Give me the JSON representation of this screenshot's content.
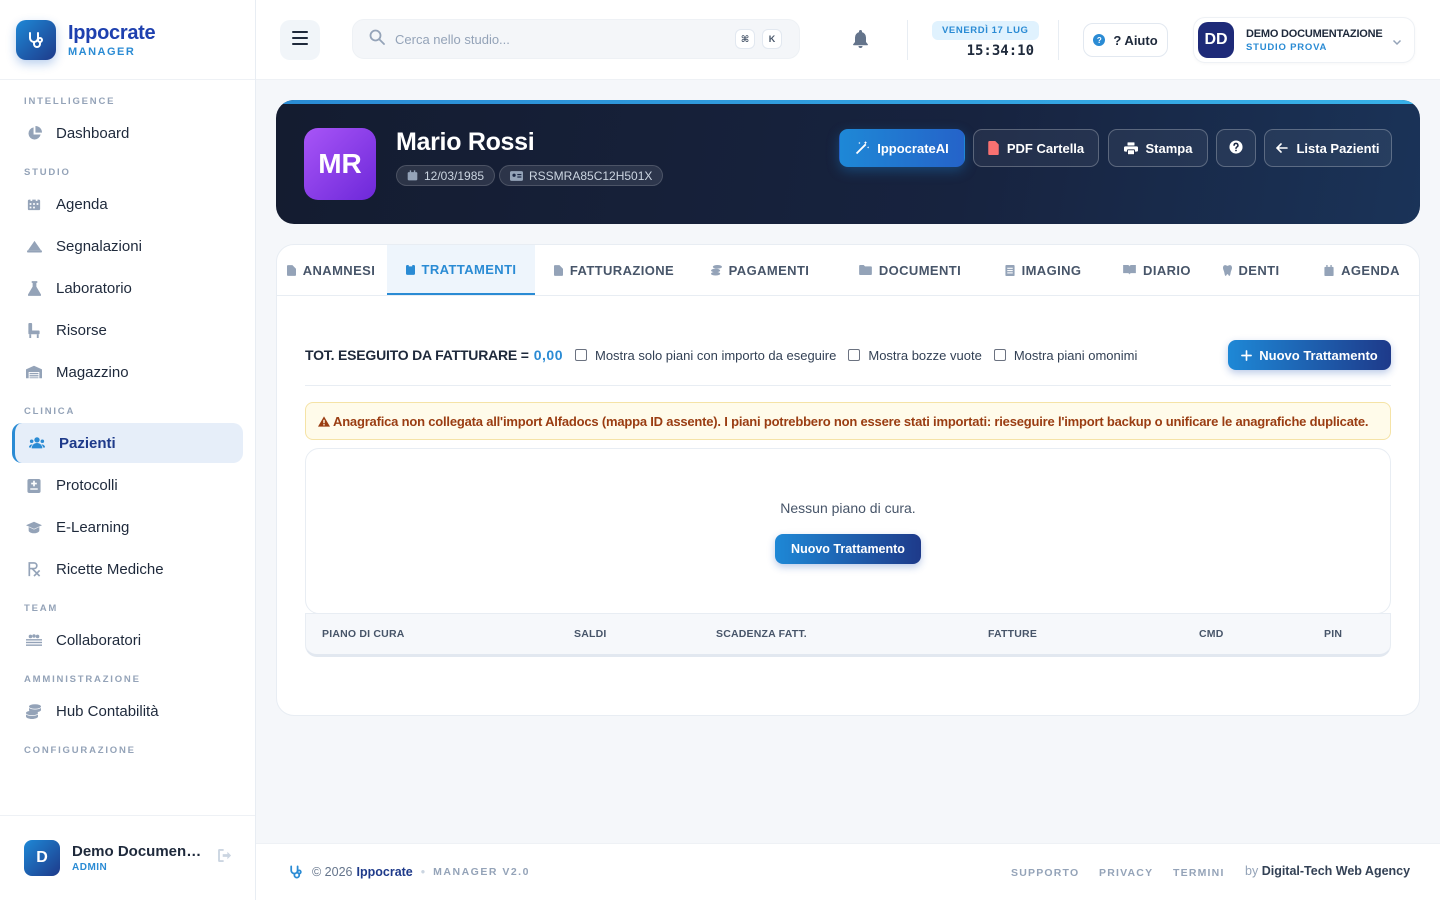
{
  "brand": {
    "name": "Ippocrate",
    "sub": "MANAGER"
  },
  "sidebar": {
    "sections": [
      {
        "title": "INTELLIGENCE",
        "items": [
          {
            "label": "Dashboard",
            "icon": "pie-chart-icon"
          }
        ]
      },
      {
        "title": "STUDIO",
        "items": [
          {
            "label": "Agenda",
            "icon": "calendar-icon"
          },
          {
            "label": "Segnalazioni",
            "icon": "bell-icon"
          },
          {
            "label": "Laboratorio",
            "icon": "flask-icon"
          },
          {
            "label": "Risorse",
            "icon": "chair-icon"
          },
          {
            "label": "Magazzino",
            "icon": "warehouse-icon"
          }
        ]
      },
      {
        "title": "CLINICA",
        "items": [
          {
            "label": "Pazienti",
            "icon": "users-icon",
            "active": true
          },
          {
            "label": "Protocolli",
            "icon": "clipboard-icon"
          },
          {
            "label": "E-Learning",
            "icon": "graduation-cap-icon"
          },
          {
            "label": "Ricette Mediche",
            "icon": "prescription-icon"
          }
        ]
      },
      {
        "title": "TEAM",
        "items": [
          {
            "label": "Collaboratori",
            "icon": "team-icon"
          }
        ]
      },
      {
        "title": "AMMINISTRAZIONE",
        "items": [
          {
            "label": "Hub Contabilità",
            "icon": "coins-icon"
          }
        ]
      },
      {
        "title": "CONFIGURAZIONE",
        "items": []
      }
    ],
    "footer": {
      "initial": "D",
      "name": "Demo Documentazione",
      "role": "ADMIN"
    }
  },
  "topbar": {
    "search_placeholder": "Cerca nello studio...",
    "kbd1": "⌘",
    "kbd2": "K",
    "date": "VENERDÌ 17 LUG",
    "time": "15:34:10",
    "help_label": "? Aiuto",
    "help_icon": "?",
    "user": {
      "initials": "DD",
      "name": "DEMO DOCUMENTAZIONE",
      "org": "STUDIO PROVA"
    }
  },
  "patient": {
    "initials": "MR",
    "name": "Mario Rossi",
    "birthdate": "12/03/1985",
    "fiscal_code": "RSSMRA85C12H501X",
    "buttons": {
      "ai": "IppocrateAI",
      "pdf": "PDF Cartella",
      "print": "Stampa",
      "list": "Lista Pazienti"
    }
  },
  "tabs": [
    {
      "label": "ANAMNESI"
    },
    {
      "label": "TRATTAMENTI",
      "active": true
    },
    {
      "label": "FATTURAZIONE"
    },
    {
      "label": "PAGAMENTI"
    },
    {
      "label": "DOCUMENTI"
    },
    {
      "label": "IMAGING"
    },
    {
      "label": "DIARIO"
    },
    {
      "label": "DENTI"
    },
    {
      "label": "AGENDA"
    }
  ],
  "treatments": {
    "total_label": "TOT. ESEGUITO DA FATTURARE =",
    "total_value": "0,00",
    "filters": [
      "Mostra solo piani con importo da eseguire",
      "Mostra bozze vuote",
      "Mostra piani omonimi"
    ],
    "new_button": "Nuovo Trattamento",
    "warning": "Anagrafica non collegata all'import Alfadocs (mappa ID assente). I piani potrebbero non essere stati importati: rieseguire l'import backup o unificare le anagrafiche duplicate.",
    "empty_text": "Nessun piano di cura.",
    "empty_button": "Nuovo Trattamento",
    "columns": [
      "PIANO DI CURA",
      "SALDI",
      "SCADENZA FATT.",
      "FATTURE",
      "CMD",
      "PIN"
    ]
  },
  "footer": {
    "copyright": "© 2026",
    "brand": "Ippocrate",
    "version": "MANAGER V2.0",
    "links": [
      "SUPPORTO",
      "PRIVACY",
      "TERMINI"
    ],
    "by_prefix": "by",
    "by_name": "Digital-Tech Web Agency"
  },
  "colors": {
    "accent": "#2a8bd4",
    "brand_dark": "#1e3a8a",
    "warning_text": "#9a3d12"
  }
}
